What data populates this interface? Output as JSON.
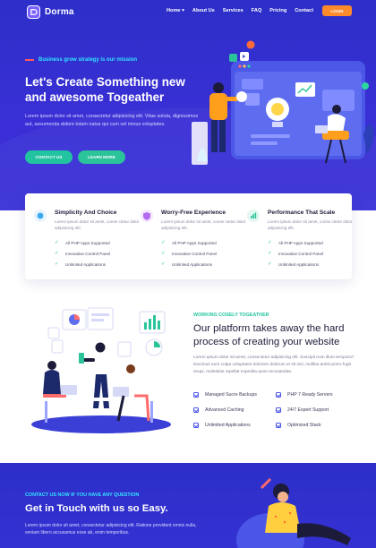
{
  "brand": {
    "name": "Dorma"
  },
  "nav": {
    "items": [
      "Home ▾",
      "About Us",
      "Services",
      "FAQ",
      "Pricing",
      "Contact"
    ],
    "login": "LOGIN"
  },
  "hero": {
    "eyebrow": "Business grow strategy is our mission",
    "title": "Let's Create Something new and awesome Togeather",
    "description": "Lorem ipsum dolor sit amet, consectetur adipisicing elit. Vitae soluta, dignissimos aut, assumenda dolore totam natus qui cum vel minus voluptates.",
    "primary_button": "CONTACT US",
    "secondary_button": "LEARN MORE"
  },
  "features": [
    {
      "title": "Simplicity And Choice",
      "description": "Lorem ipsum dolor sit amet, conse ctetur dolor adipisicing elit.",
      "items": [
        "All PHP Apps Supported",
        "Innovative Control Panel",
        "Unlimited Applications"
      ],
      "icon": "cube-icon",
      "color": "#3aa8f0"
    },
    {
      "title": "Worry-Free Experience",
      "description": "Lorem ipsum dolor sit amet, conse ctetur dolor adipisicing elit.",
      "items": [
        "All PHP Apps Supported",
        "Innovative Control Panel",
        "Unlimited Applications"
      ],
      "icon": "shield-icon",
      "color": "#b36bf0"
    },
    {
      "title": "Performance That Scale",
      "description": "Lorem ipsum dolor sit amet, conse ctetur dolor adipisicing elit.",
      "items": [
        "All PHP Apps Supported",
        "Innovative Control Panel",
        "Unlimited Applications"
      ],
      "icon": "chart-icon",
      "color": "#2bc39a"
    }
  ],
  "about": {
    "eyebrow": "WORKING COSELY TOGEATHER",
    "title": "Our platform takes away the hard process of creating your website",
    "description": "Lorem ipsum dolor sit amet, consectetur adipisicing elit. Suscipit eum illum tempora? Ducimus eum culpa voluptates dolorem dolorum et sit nisi, mollitia animi porro fugit sequi, molestias repellat expedita quos recusandae.",
    "items": [
      "Managed Sucre Backups",
      "PHP 7 Ready Servers",
      "Advanced Caching",
      "24/7 Expert Support",
      "Unlimited Applications",
      "Optimized Stack"
    ]
  },
  "contact": {
    "eyebrow": "CONTACT US NOW IF YOU HAVE ANY QUESTION",
    "title": "Get in Touch with us so Easy.",
    "description": "Lorem ipsum dolor sit amet, consectetur adipisicing elit. Ratione provident omnis nulla, veniam libero accusamus esse ab, enim temporibus."
  },
  "colors": {
    "brand_blue": "#2d2fc8",
    "accent_orange": "#ff8a2b",
    "accent_green": "#22c3a0",
    "accent_cyan": "#33e6ff"
  }
}
